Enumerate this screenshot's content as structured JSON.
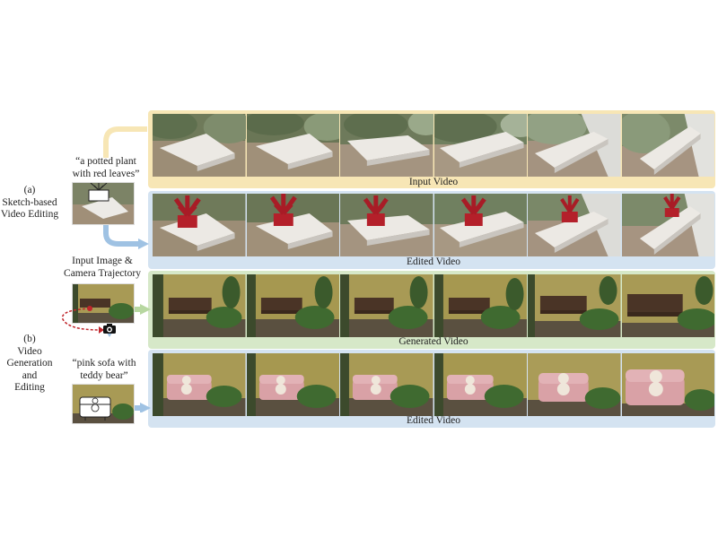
{
  "section_a": {
    "label_letter": "(a)",
    "label_line1": "Sketch-based",
    "label_line2": "Video Editing",
    "prompt_line1": "“a potted plant",
    "prompt_line2": "with red leaves”",
    "row1_caption": "Input Video",
    "row2_caption": "Edited Video"
  },
  "section_b": {
    "label_letter": "(b)",
    "label_line1": "Video",
    "label_line2": "Generation",
    "label_line3": "and",
    "label_line4": "Editing",
    "input_line1": "Input Image &",
    "input_line2": "Camera Trajectory",
    "prompt_line1": "“pink sofa with",
    "prompt_line2": "teddy bear”",
    "row3_caption": "Generated Video",
    "row4_caption": "Edited Video"
  },
  "colors": {
    "panel_yellow": "#f7e6b5",
    "panel_blue": "#d4e3f1",
    "panel_green": "#d6e8c8",
    "arrow_blue": "#9fc2e3",
    "arrow_green": "#b7d7a0",
    "trajectory_red": "#c0262c"
  },
  "icons": [
    "camera-icon",
    "sketch-plant-icon",
    "sketch-sofa-icon"
  ]
}
